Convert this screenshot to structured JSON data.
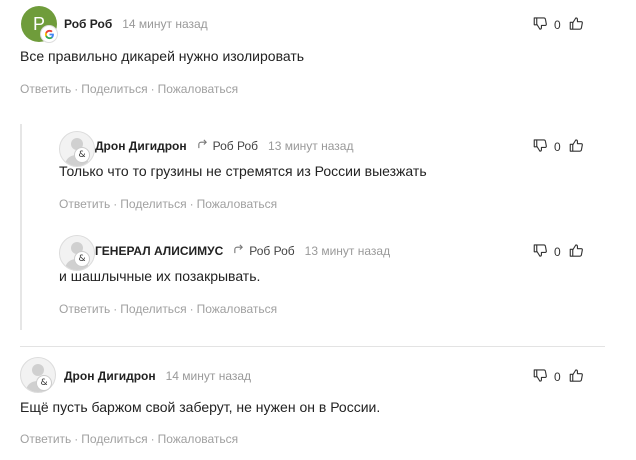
{
  "icons": {
    "dislike": "thumb-down-icon",
    "like": "thumb-up-icon",
    "reply": "reply-arrow-icon",
    "google": "google-icon",
    "avatar": "user-silhouette-icon"
  },
  "colors": {
    "avatar_green": "#6f9c3b",
    "muted": "#999999",
    "text": "#222222"
  },
  "actions": {
    "reply": "Ответить",
    "share": "Поделиться",
    "report": "Пожаловаться",
    "separator": "·"
  },
  "comments": [
    {
      "avatar_letter": "Р",
      "author": "Роб Роб",
      "time": "14 минут назад",
      "text": "Все правильно дикарей нужно изолировать",
      "dislikes": "0"
    },
    {
      "author": "Дрон Дигидрон",
      "reply_to": "Роб Роб",
      "time": "13 минут назад",
      "text": "Только что то грузины не стремятся из России выезжать",
      "dislikes": "0"
    },
    {
      "author": "ГЕНЕРАЛ АЛИСИМУС",
      "reply_to": "Роб Роб",
      "time": "13 минут назад",
      "text": "и шашлычные их позакрывать.",
      "dislikes": "0"
    },
    {
      "author": "Дрон Дигидрон",
      "time": "14 минут назад",
      "text": "Ещё пусть баржом свой заберут, не нужен он в России.",
      "dislikes": "0"
    }
  ]
}
